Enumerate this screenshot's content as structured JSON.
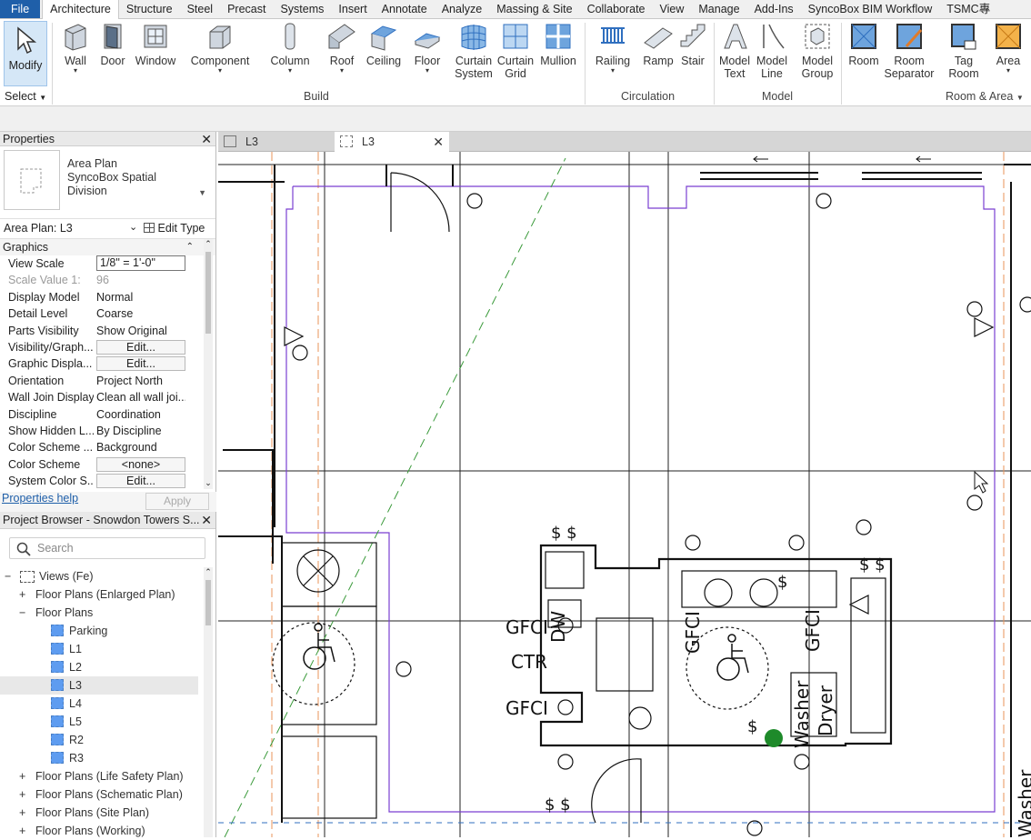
{
  "menu_tabs": [
    "File",
    "Architecture",
    "Structure",
    "Steel",
    "Precast",
    "Systems",
    "Insert",
    "Annotate",
    "Analyze",
    "Massing & Site",
    "Collaborate",
    "View",
    "Manage",
    "Add-Ins",
    "SyncoBox BIM Workflow",
    "TSMC專"
  ],
  "ribbon": {
    "modify": "Modify",
    "select": "Select",
    "wall": "Wall",
    "door": "Door",
    "window": "Window",
    "component": "Component",
    "column": "Column",
    "roof": "Roof",
    "ceiling": "Ceiling",
    "floor": "Floor",
    "curtain_system_1": "Curtain",
    "curtain_system_2": "System",
    "curtain_grid_1": "Curtain",
    "curtain_grid_2": "Grid",
    "mullion": "Mullion",
    "railing": "Railing",
    "ramp": "Ramp",
    "stair": "Stair",
    "model_text_1": "Model",
    "model_text_2": "Text",
    "model_line_1": "Model",
    "model_line_2": "Line",
    "model_group_1": "Model",
    "model_group_2": "Group",
    "room": "Room",
    "room_sep_1": "Room",
    "room_sep_2": "Separator",
    "tag_room_1": "Tag",
    "tag_room_2": "Room",
    "area": "Area",
    "panel_build": "Build",
    "panel_circulation": "Circulation",
    "panel_model": "Model",
    "panel_room_area": "Room & Area"
  },
  "properties": {
    "title": "Properties",
    "type_line1": "Area Plan",
    "type_line2": "SyncoBox Spatial",
    "type_line3": "Division",
    "instance": "Area Plan: L3",
    "edit_type": "Edit Type",
    "group": "Graphics",
    "rows": [
      {
        "k": "View Scale",
        "v": "1/8\" = 1'-0\""
      },
      {
        "k": "Scale Value    1:",
        "v": "96"
      },
      {
        "k": "Display Model",
        "v": "Normal"
      },
      {
        "k": "Detail Level",
        "v": "Coarse"
      },
      {
        "k": "Parts Visibility",
        "v": "Show Original"
      },
      {
        "k": "Visibility/Graph...",
        "v": "Edit..."
      },
      {
        "k": "Graphic Displa...",
        "v": "Edit..."
      },
      {
        "k": "Orientation",
        "v": "Project North"
      },
      {
        "k": "Wall Join Display",
        "v": "Clean all wall joi..."
      },
      {
        "k": "Discipline",
        "v": "Coordination"
      },
      {
        "k": "Show Hidden L...",
        "v": "By Discipline"
      },
      {
        "k": "Color Scheme ...",
        "v": "Background"
      },
      {
        "k": "Color Scheme",
        "v": "<none>"
      },
      {
        "k": "System Color S...",
        "v": "Edit..."
      }
    ],
    "help": "Properties help",
    "apply": "Apply"
  },
  "browser": {
    "title": "Project Browser - Snowdon Towers S...",
    "search_placeholder": "Search",
    "items": [
      {
        "label": "Views (Fe)"
      },
      {
        "label": "Floor Plans (Enlarged Plan)"
      },
      {
        "label": "Floor Plans"
      },
      {
        "label": "Parking"
      },
      {
        "label": "L1"
      },
      {
        "label": "L2"
      },
      {
        "label": "L3"
      },
      {
        "label": "L4"
      },
      {
        "label": "L5"
      },
      {
        "label": "R2"
      },
      {
        "label": "R3"
      },
      {
        "label": "Floor Plans (Life Safety Plan)"
      },
      {
        "label": "Floor Plans (Schematic Plan)"
      },
      {
        "label": "Floor Plans (Site Plan)"
      },
      {
        "label": "Floor Plans (Working)"
      }
    ]
  },
  "view_tabs": [
    "L3",
    "L3"
  ],
  "drawing": {
    "gfci_1": "GFCI",
    "ctr": "CTR",
    "gfci_2": "GFCI",
    "dw": "DW",
    "gfci_v1": "GFCI",
    "gfci_v2": "GFCI",
    "washer": "Washer",
    "dryer": "Dryer",
    "washer_edge": "Washer"
  },
  "colors": {
    "file_tab": "#1f5fa9",
    "area_boundary": "#7a3fd1",
    "green_dash": "#3a9a3a",
    "grid_orange": "#e8935a",
    "icon_blue": "#2f6fbf"
  }
}
